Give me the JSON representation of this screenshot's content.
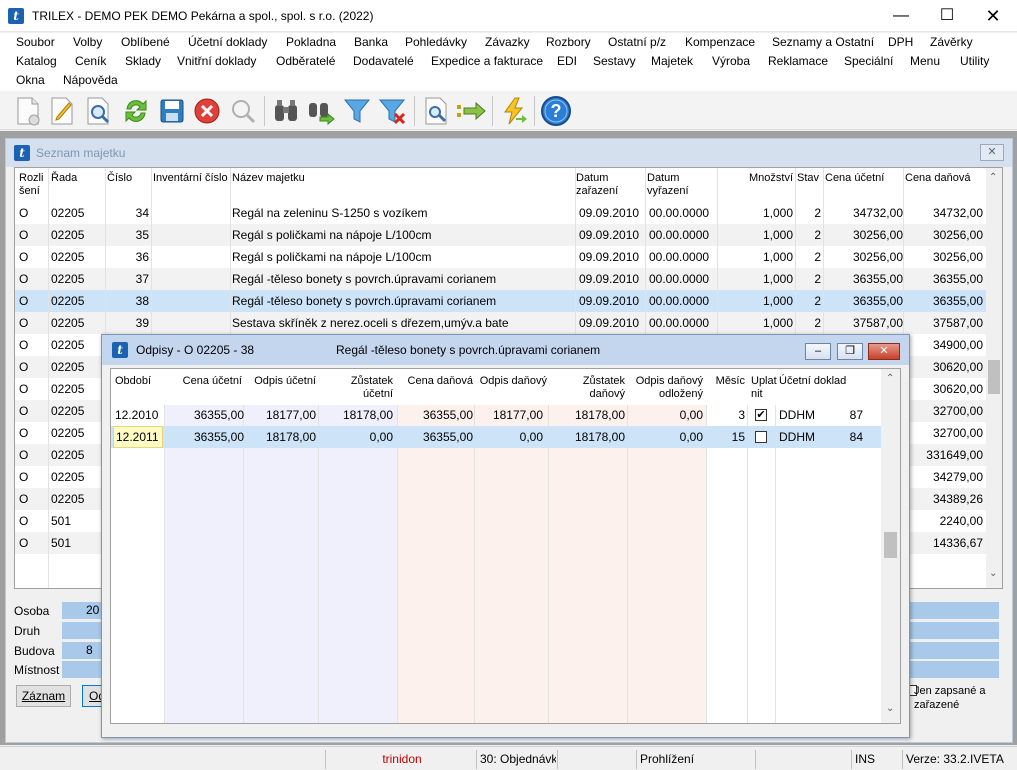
{
  "window": {
    "title": "TRILEX - DEMO PEK DEMO Pekárna a spol., spol. s r.o. (2022)",
    "app_icon_letter": "t"
  },
  "menu": {
    "row1": [
      "Soubor",
      "Volby",
      "Oblíbené",
      "Účetní doklady",
      "Pokladna",
      "Banka",
      "Pohledávky",
      "Závazky",
      "Rozbory",
      "Ostatní p/z",
      "Kompenzace",
      "Seznamy a Ostatní",
      "DPH",
      "Závěrky"
    ],
    "row2": [
      "Katalog",
      "Ceník",
      "Sklady",
      "Vnitřní doklady",
      "Odběratelé",
      "Dodavatelé",
      "Expedice a fakturace",
      "EDI",
      "Sestavy",
      "Majetek",
      "Výroba",
      "Reklamace",
      "Speciální",
      "Menu",
      "Utility"
    ],
    "row3": [
      "Okna",
      "Nápověda"
    ]
  },
  "toolbar": {
    "icons": [
      "new-document-icon",
      "edit-document-icon",
      "preview-document-icon",
      "refresh-icon",
      "save-icon",
      "cancel-icon",
      "search-icon",
      "binoculars-icon",
      "binoculars-next-icon",
      "filter-icon",
      "filter-clear-icon",
      "print-preview-icon",
      "arrow-right-icon",
      "lightning-icon",
      "help-icon"
    ],
    "help_glyph": "?"
  },
  "seznam": {
    "title": "Seznam majetku",
    "close_glyph": "✕",
    "columns": {
      "rozliseni": "Rozli šení",
      "rada": "Řada",
      "cislo": "Číslo",
      "inventarni": "Inventární číslo",
      "nazev": "Název majetku",
      "datum_zarazeni": "Datum zařazení",
      "datum_vyrazeni": "Datum vyřazení",
      "mnozstvi": "Množství",
      "stav": "Stav",
      "cena_ucetni": "Cena účetní",
      "cena_danova": "Cena daňová"
    },
    "rows": [
      {
        "rozl": "O",
        "rada": "02205",
        "cislo": "34",
        "nazev": "Regál na zeleninu S-1250 s vozíkem",
        "dz": "09.09.2010",
        "dv": "00.00.0000",
        "mn": "1,000",
        "stav": "2",
        "cu": "34732,00",
        "cd": "34732,00"
      },
      {
        "rozl": "O",
        "rada": "02205",
        "cislo": "35",
        "nazev": "Regál s poličkami na nápoje L/100cm",
        "dz": "09.09.2010",
        "dv": "00.00.0000",
        "mn": "1,000",
        "stav": "2",
        "cu": "30256,00",
        "cd": "30256,00"
      },
      {
        "rozl": "O",
        "rada": "02205",
        "cislo": "36",
        "nazev": "Regál s poličkami na nápoje L/100cm",
        "dz": "09.09.2010",
        "dv": "00.00.0000",
        "mn": "1,000",
        "stav": "2",
        "cu": "30256,00",
        "cd": "30256,00"
      },
      {
        "rozl": "O",
        "rada": "02205",
        "cislo": "37",
        "nazev": "Regál -těleso bonety s povrch.úpravami corianem",
        "dz": "09.09.2010",
        "dv": "00.00.0000",
        "mn": "1,000",
        "stav": "2",
        "cu": "36355,00",
        "cd": "36355,00"
      },
      {
        "rozl": "O",
        "rada": "02205",
        "cislo": "38",
        "nazev": "Regál -těleso bonety s povrch.úpravami corianem",
        "dz": "09.09.2010",
        "dv": "00.00.0000",
        "mn": "1,000",
        "stav": "2",
        "cu": "36355,00",
        "cd": "36355,00"
      },
      {
        "rozl": "O",
        "rada": "02205",
        "cislo": "39",
        "nazev": "Sestava skříněk z nerez.oceli s dřezem,umýv.a bate",
        "dz": "09.09.2010",
        "dv": "00.00.0000",
        "mn": "1,000",
        "stav": "2",
        "cu": "37587,00",
        "cd": "37587,00"
      },
      {
        "rozl": "O",
        "rada": "02205",
        "cislo": "",
        "nazev": "",
        "dz": "",
        "dv": "",
        "mn": "",
        "stav": "",
        "cu": "",
        "cd": "34900,00"
      },
      {
        "rozl": "O",
        "rada": "02205",
        "cislo": "",
        "nazev": "",
        "dz": "",
        "dv": "",
        "mn": "",
        "stav": "",
        "cu": "",
        "cd": "30620,00"
      },
      {
        "rozl": "O",
        "rada": "02205",
        "cislo": "",
        "nazev": "",
        "dz": "",
        "dv": "",
        "mn": "",
        "stav": "",
        "cu": "",
        "cd": "30620,00"
      },
      {
        "rozl": "O",
        "rada": "02205",
        "cislo": "",
        "nazev": "",
        "dz": "",
        "dv": "",
        "mn": "",
        "stav": "",
        "cu": "",
        "cd": "32700,00"
      },
      {
        "rozl": "O",
        "rada": "02205",
        "cislo": "",
        "nazev": "",
        "dz": "",
        "dv": "",
        "mn": "",
        "stav": "",
        "cu": "",
        "cd": "32700,00"
      },
      {
        "rozl": "O",
        "rada": "02205",
        "cislo": "",
        "nazev": "",
        "dz": "",
        "dv": "",
        "mn": "",
        "stav": "",
        "cu": "",
        "cd": "331649,00"
      },
      {
        "rozl": "O",
        "rada": "02205",
        "cislo": "",
        "nazev": "",
        "dz": "",
        "dv": "",
        "mn": "",
        "stav": "",
        "cu": "",
        "cd": "34279,00"
      },
      {
        "rozl": "O",
        "rada": "02205",
        "cislo": "",
        "nazev": "",
        "dz": "",
        "dv": "",
        "mn": "",
        "stav": "",
        "cu": "",
        "cd": "34389,26"
      },
      {
        "rozl": "O",
        "rada": "501",
        "cislo": "",
        "nazev": "",
        "dz": "",
        "dv": "",
        "mn": "",
        "stav": "",
        "cu": "",
        "cd": "2240,00"
      },
      {
        "rozl": "O",
        "rada": "501",
        "cislo": "",
        "nazev": "",
        "dz": "",
        "dv": "",
        "mn": "",
        "stav": "",
        "cu": "",
        "cd": "14336,67"
      }
    ],
    "selected_row": 4,
    "fields": {
      "osoba": "Osoba",
      "osoba_val": "20",
      "druh": "Druh",
      "budova": "Budova",
      "budova_val": "8",
      "mistnost": "Místnost"
    },
    "buttons": {
      "zaznam": "Záznam",
      "od": "Od"
    },
    "checkbox_label": "Jen zapsané a zařazené"
  },
  "odpisy": {
    "title": "Odpisy - O 02205 - 38",
    "subtitle": "Regál -těleso bonety s povrch.úpravami corianem",
    "columns": {
      "obdobi": "Období",
      "cena_ucetni": "Cena účetní",
      "odpis_ucetni": "Odpis účetní",
      "zustatek_ucetni": "Zůstatek účetní",
      "cena_danova": "Cena daňová",
      "odpis_danovy": "Odpis daňový",
      "zustatek_danovy": "Zůstatek daňový",
      "odpis_odlozeny": "Odpis daňový odložený",
      "mesic": "Měsíc",
      "uplatnit": "Uplat nit",
      "ucetni_doklad": "Účetní doklad"
    },
    "rows": [
      {
        "obdobi": "12.2010",
        "cu": "36355,00",
        "ou": "18177,00",
        "zu": "18178,00",
        "cd": "36355,00",
        "od": "18177,00",
        "zd": "18178,00",
        "oo": "0,00",
        "mesic": "3",
        "uplatnit": true,
        "dokl": "DDHM",
        "dokl_no": "87"
      },
      {
        "obdobi": "12.2011",
        "cu": "36355,00",
        "ou": "18178,00",
        "zu": "0,00",
        "cd": "36355,00",
        "od": "0,00",
        "zd": "18178,00",
        "oo": "0,00",
        "mesic": "15",
        "uplatnit": false,
        "dokl": "DDHM",
        "dokl_no": "84"
      }
    ],
    "controls": {
      "minimize": "‒",
      "restore": "❐",
      "close": "✕"
    }
  },
  "status": {
    "user": "trinidon",
    "module": "30: Objednávk",
    "mode": "Prohlížení",
    "ins": "INS",
    "version": "Verze: 33.2.IVETA"
  },
  "colors": {
    "accent": "#1b62b3",
    "selection": "#cde3f8",
    "input_highlight": "#fffbc2",
    "status_user": "#c00000"
  }
}
